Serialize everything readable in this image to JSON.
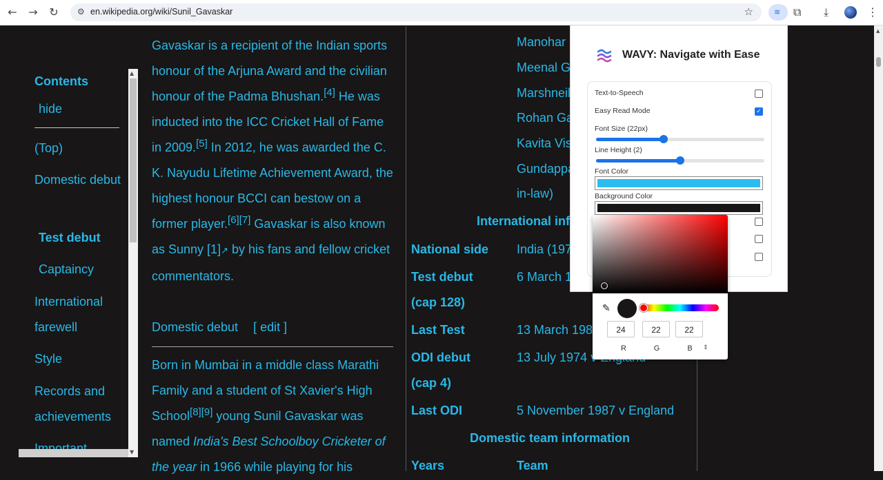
{
  "browser": {
    "url": "en.wikipedia.org/wiki/Sunil_Gavaskar",
    "back_icon": "←",
    "forward_icon": "→",
    "reload_icon": "↻",
    "tune_icon": "⚙",
    "star_icon": "☆",
    "ext_wave_icon": "≋",
    "puzzle_icon": "⧉",
    "download_icon": "⤓",
    "menu_icon": "⋮"
  },
  "toc": {
    "title": "Contents",
    "hide": "hide",
    "items": [
      "(Top)",
      "Domestic debut",
      "Test debut",
      "Captaincy",
      "International farewell",
      "Style",
      "Records and achievements",
      "Important"
    ]
  },
  "article": {
    "p1": {
      "t1": "Gavaskar is a recipient of the Indian sports honour of the Arjuna Award and the civilian honour of the Padma Bhushan.",
      "ref4": "[4]",
      "t2": " He was inducted into the ICC Cricket Hall of Fame in 2009.",
      "ref5": "[5]",
      "t3": " In 2012, he was awarded the C. K. Nayudu Lifetime Achievement Award, the highest honour BCCI can bestow on a former player.",
      "ref67": "[6][7]",
      "t4": " Gavaskar is also known as Sunny [1]",
      "ext_icon": "↗",
      "t5": " by his fans and fellow cricket commentators."
    },
    "section_heading": "Domestic debut",
    "edit_link": "[ edit ]",
    "p2": {
      "t1": "Born in Mumbai in a middle class Marathi Family and a student of St Xavier's High School",
      "ref89": "[8][9]",
      "t2": " young Sunil Gavaskar was named ",
      "em": "India's Best Schoolboy Cricketer of the year",
      "t3": " in 1966 while playing for his"
    }
  },
  "infobox": {
    "relatives": [
      "Manohar",
      "Meenal G",
      "Marshneil",
      "Rohan Ga",
      "Kavita Vis",
      "Gundappa",
      "in-law)"
    ],
    "intl_heading": "International inf",
    "rows": [
      {
        "label": "National side",
        "value": "India (197"
      },
      {
        "label": "Test debut",
        "label2": "(cap 128)",
        "value": "6 March 1"
      },
      {
        "label": "Last Test",
        "value": "13 March 198"
      },
      {
        "label": "ODI debut",
        "label2": "(cap 4)",
        "value": "13 July 1974 v England"
      },
      {
        "label": "Last ODI",
        "value": "5 November 1987 v England"
      }
    ],
    "domestic_heading": "Domestic team information",
    "years_label": "Years",
    "team_label": "Team"
  },
  "popup": {
    "title": "WAVY: Navigate with Ease",
    "logo_icon": "wave-logo",
    "text_to_speech": "Text-to-Speech",
    "easy_read": "Easy Read Mode",
    "easy_read_checked": true,
    "text_to_speech_checked": false,
    "checkmark": "✓",
    "font_size_label": "Font Size (22px)",
    "font_size_fraction": 0.4,
    "line_height_label": "Line Height (2)",
    "line_height_fraction": 0.5,
    "font_color_label": "Font Color",
    "font_color": "#2cbcf0",
    "bg_color_label": "Background Color",
    "bg_color": "#181616"
  },
  "picker": {
    "hue_color": "#ff0000",
    "preview_color": "#181616",
    "eyedropper_icon": "✎",
    "r": "24",
    "g": "22",
    "b": "22",
    "r_label": "R",
    "g_label": "G",
    "b_label": "B",
    "mode_icon": "⇕"
  },
  "colors": {
    "link": "#29b8e8",
    "page_bg": "#181616"
  }
}
